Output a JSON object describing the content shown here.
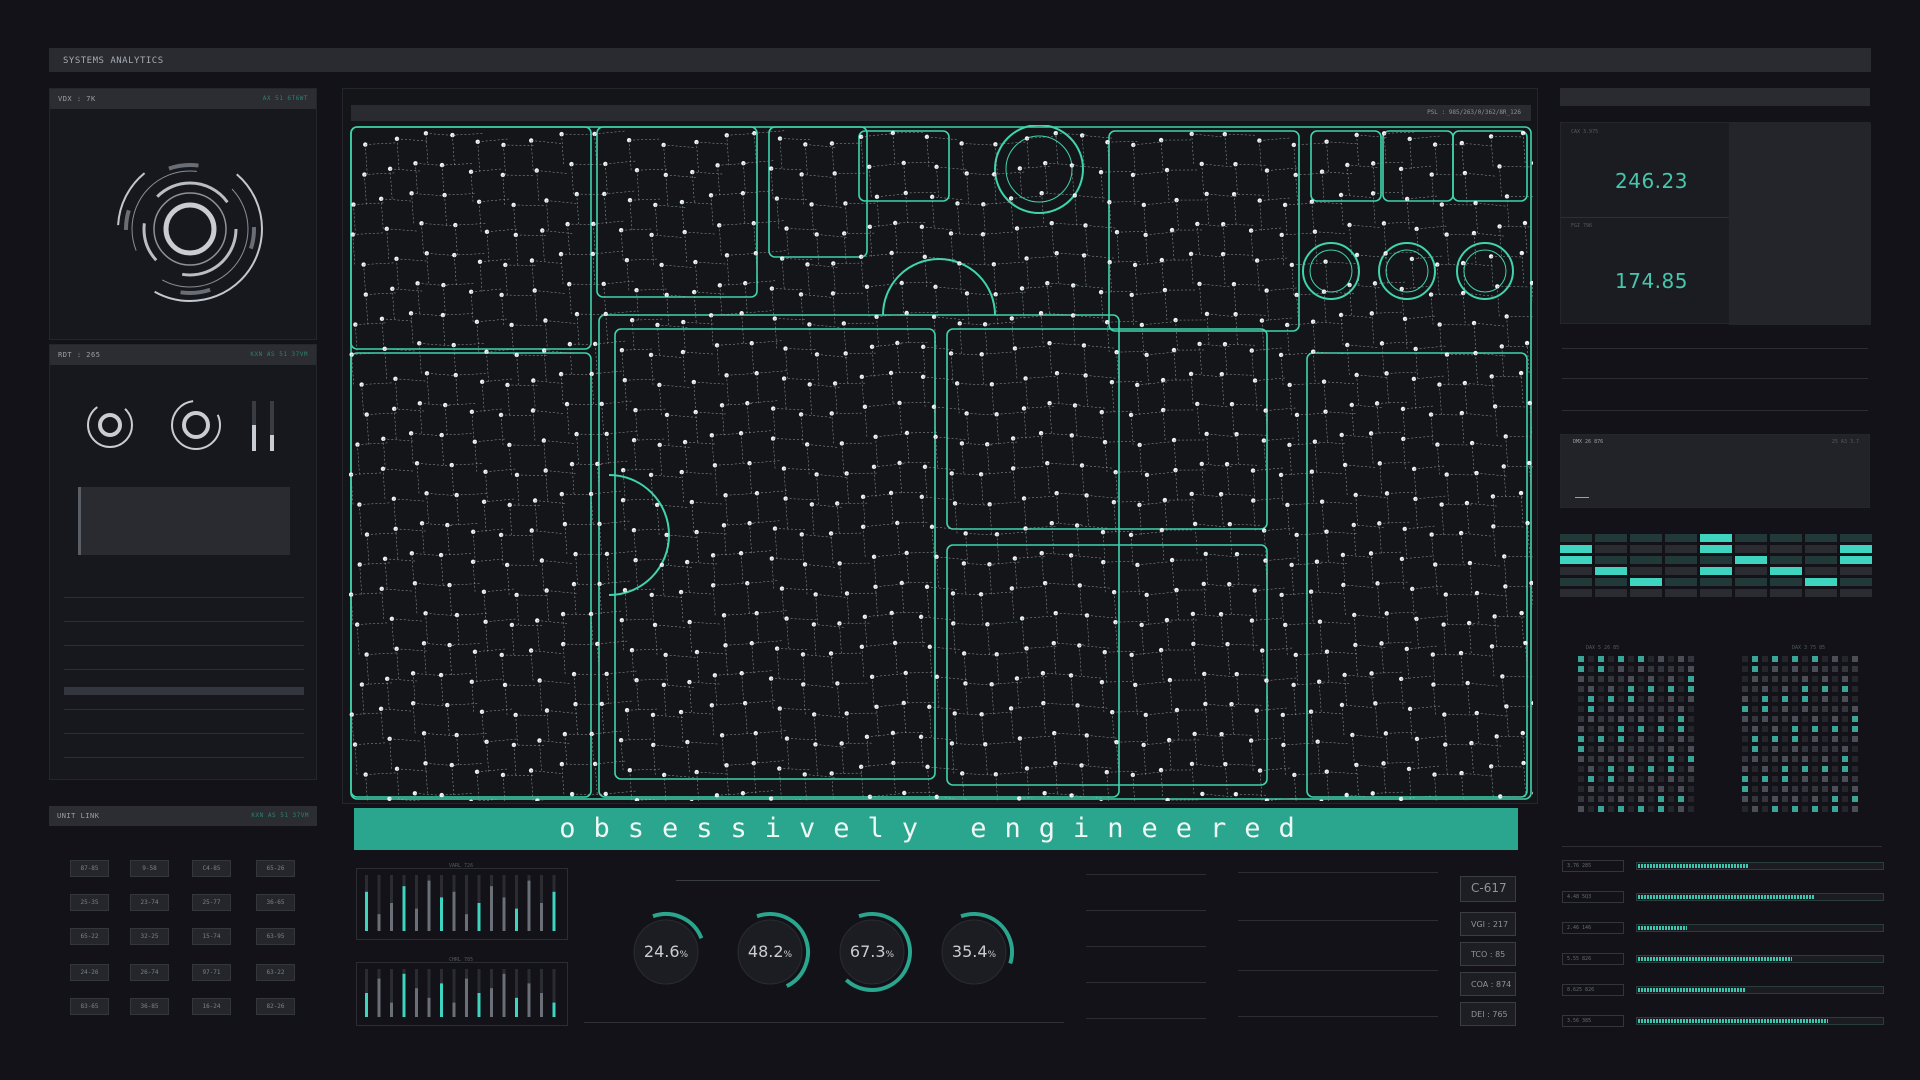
{
  "header": {
    "title": "SYSTEMS ANALYTICS"
  },
  "left_panel_1": {
    "title": "VDX : 7K",
    "right": "AX 51 6T6WT"
  },
  "left_panel_2": {
    "title": "RDT : 265",
    "right": "KXN AS 51 37VM"
  },
  "left_panel_3": {
    "title": "UNIT LINK",
    "right": "KXN AS 51 37VM"
  },
  "viewport": {
    "readout": "PSL : 985/263/0/362/8R_126"
  },
  "banner": {
    "text": "obsessively engineered"
  },
  "gauges": [
    {
      "value": "24.6",
      "unit": "%",
      "fraction": 0.246
    },
    {
      "value": "48.2",
      "unit": "%",
      "fraction": 0.482
    },
    {
      "value": "67.3",
      "unit": "%",
      "fraction": 0.673
    },
    {
      "value": "35.4",
      "unit": "%",
      "fraction": 0.354
    }
  ],
  "codes": [
    "C-617",
    "VGI : 217",
    "TCO : 85",
    "COA : 874",
    "DEI : 765"
  ],
  "units": [
    [
      "87-85",
      "9-58",
      "C4-85",
      "65-26"
    ],
    [
      "25-35",
      "23-74",
      "25-77",
      "36-65"
    ],
    [
      "65-22",
      "32-25",
      "15-74",
      "63-95"
    ],
    [
      "24-26",
      "26-74",
      "97-71",
      "63-22"
    ],
    [
      "83-65",
      "36-85",
      "16-24",
      "82-26"
    ]
  ],
  "right_stats": {
    "box1_title": "CAX 3.975",
    "box1_value": "246.23",
    "box2_title": "FGI 796",
    "box2_value": "174.85",
    "panel_title": "DMX 26 876",
    "panel_right": "25 A3 3.7",
    "grid1_title": "DAX 5 26 85",
    "grid2_title": "DAX 3 75 85"
  },
  "progress_rows": [
    {
      "label": "3.76 285",
      "fill": 0.45
    },
    {
      "label": "4.48 5Q3",
      "fill": 0.72
    },
    {
      "label": "2.46 146",
      "fill": 0.2
    },
    {
      "label": "5.55 826",
      "fill": 0.63
    },
    {
      "label": "8.625 826",
      "fill": 0.44
    },
    {
      "label": "3.56 385",
      "fill": 0.78
    }
  ],
  "bar_chart_1": {
    "title": "VARL 726",
    "values": [
      0.7,
      0.3,
      0.5,
      0.8,
      0.4,
      0.9,
      0.6,
      0.7,
      0.3,
      0.5,
      0.8,
      0.6,
      0.4,
      0.9,
      0.5,
      0.7
    ]
  },
  "bar_chart_2": {
    "title": "CHRL 785",
    "values": [
      0.5,
      0.8,
      0.3,
      0.9,
      0.6,
      0.4,
      0.7,
      0.3,
      0.8,
      0.5,
      0.6,
      0.9,
      0.4,
      0.7,
      0.5,
      0.3
    ]
  },
  "colors": {
    "accent": "#2fb39b",
    "bg": "#121218",
    "panel": "#17181d"
  }
}
